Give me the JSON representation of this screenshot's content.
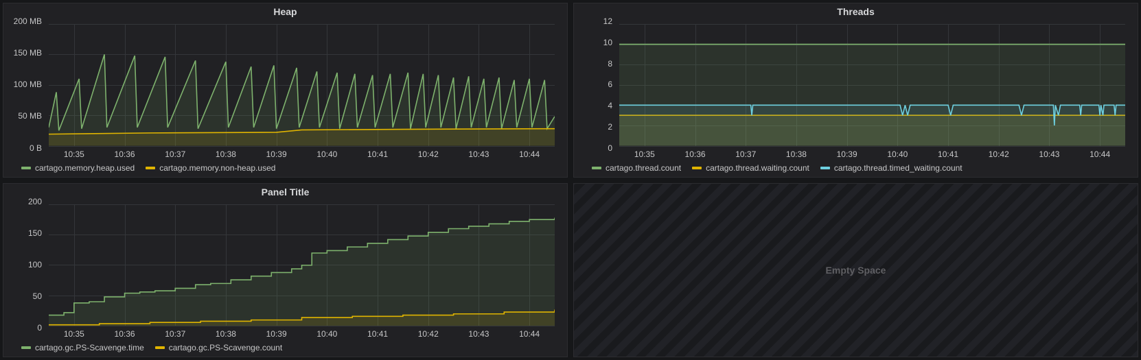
{
  "panels": {
    "heap": {
      "title": "Heap"
    },
    "threads": {
      "title": "Threads"
    },
    "gc": {
      "title": "Panel Title"
    },
    "empty": {
      "title": "Empty Space"
    }
  },
  "colors": {
    "green": "#7eb26d",
    "yellow": "#e0b400",
    "cyan": "#6ed0e0"
  },
  "x_ticks": [
    "10:35",
    "10:36",
    "10:37",
    "10:38",
    "10:39",
    "10:40",
    "10:41",
    "10:42",
    "10:43",
    "10:44"
  ],
  "legends": {
    "heap": [
      {
        "color": "green",
        "label": "cartago.memory.heap.used"
      },
      {
        "color": "yellow",
        "label": "cartago.memory.non-heap.used"
      }
    ],
    "threads": [
      {
        "color": "green",
        "label": "cartago.thread.count"
      },
      {
        "color": "yellow",
        "label": "cartago.thread.waiting.count"
      },
      {
        "color": "cyan",
        "label": "cartago.thread.timed_waiting.count"
      }
    ],
    "gc": [
      {
        "color": "green",
        "label": "cartago.gc.PS-Scavenge.time"
      },
      {
        "color": "yellow",
        "label": "cartago.gc.PS-Scavenge.count"
      }
    ]
  },
  "chart_data": [
    {
      "id": "heap",
      "type": "area",
      "title": "Heap",
      "xlabel": "",
      "ylabel": "",
      "ylim": [
        0,
        200
      ],
      "y_ticks": [
        "0 B",
        "50 MB",
        "100 MB",
        "150 MB",
        "200 MB"
      ],
      "x": [
        0,
        0.5,
        1,
        1.5,
        2,
        2.5,
        3,
        3.5,
        4,
        4.5,
        5,
        5.5,
        6,
        6.5,
        7,
        7.5,
        8,
        8.5,
        9,
        9.5,
        10
      ],
      "series": [
        {
          "name": "cartago.memory.heap.used",
          "color": "green",
          "values": [
            [
              0.0,
              30
            ],
            [
              0.15,
              88
            ],
            [
              0.2,
              25
            ],
            [
              0.6,
              110
            ],
            [
              0.65,
              28
            ],
            [
              1.1,
              150
            ],
            [
              1.15,
              30
            ],
            [
              1.7,
              148
            ],
            [
              1.75,
              30
            ],
            [
              2.3,
              146
            ],
            [
              2.35,
              30
            ],
            [
              2.9,
              140
            ],
            [
              2.95,
              28
            ],
            [
              3.5,
              138
            ],
            [
              3.55,
              30
            ],
            [
              4.0,
              130
            ],
            [
              4.05,
              30
            ],
            [
              4.45,
              132
            ],
            [
              4.5,
              28
            ],
            [
              4.9,
              128
            ],
            [
              4.95,
              30
            ],
            [
              5.3,
              122
            ],
            [
              5.35,
              30
            ],
            [
              5.7,
              120
            ],
            [
              5.75,
              28
            ],
            [
              6.05,
              118
            ],
            [
              6.1,
              30
            ],
            [
              6.4,
              116
            ],
            [
              6.45,
              30
            ],
            [
              6.75,
              118
            ],
            [
              6.8,
              30
            ],
            [
              7.1,
              120
            ],
            [
              7.15,
              28
            ],
            [
              7.4,
              118
            ],
            [
              7.45,
              30
            ],
            [
              7.7,
              116
            ],
            [
              7.75,
              30
            ],
            [
              8.0,
              112
            ],
            [
              8.05,
              28
            ],
            [
              8.3,
              114
            ],
            [
              8.35,
              30
            ],
            [
              8.6,
              110
            ],
            [
              8.65,
              30
            ],
            [
              8.9,
              112
            ],
            [
              8.95,
              28
            ],
            [
              9.2,
              108
            ],
            [
              9.25,
              30
            ],
            [
              9.5,
              110
            ],
            [
              9.55,
              30
            ],
            [
              9.8,
              108
            ],
            [
              9.85,
              28
            ],
            [
              10.0,
              48
            ]
          ]
        },
        {
          "name": "cartago.memory.non-heap.used",
          "color": "yellow",
          "values": [
            [
              0.0,
              19
            ],
            [
              2.0,
              21
            ],
            [
              4.5,
              22
            ],
            [
              5.0,
              26
            ],
            [
              7.0,
              27
            ],
            [
              10.0,
              28
            ]
          ]
        }
      ]
    },
    {
      "id": "threads",
      "type": "area",
      "title": "Threads",
      "xlabel": "",
      "ylabel": "",
      "ylim": [
        0,
        12
      ],
      "y_ticks": [
        "0",
        "2",
        "4",
        "6",
        "8",
        "10",
        "12"
      ],
      "x": [
        0,
        1,
        2,
        3,
        4,
        5,
        6,
        7,
        8,
        9,
        10
      ],
      "series": [
        {
          "name": "cartago.thread.count",
          "color": "green",
          "values": [
            [
              0,
              10
            ],
            [
              10,
              10
            ]
          ]
        },
        {
          "name": "cartago.thread.waiting.count",
          "color": "yellow",
          "values": [
            [
              0,
              3
            ],
            [
              10,
              3
            ]
          ]
        },
        {
          "name": "cartago.thread.timed_waiting.count",
          "color": "cyan",
          "values": [
            [
              0.0,
              4
            ],
            [
              2.6,
              4
            ],
            [
              2.62,
              3
            ],
            [
              2.64,
              4
            ],
            [
              5.55,
              4
            ],
            [
              5.6,
              3
            ],
            [
              5.65,
              4
            ],
            [
              5.7,
              3
            ],
            [
              5.75,
              4
            ],
            [
              6.5,
              4
            ],
            [
              6.55,
              3
            ],
            [
              6.6,
              4
            ],
            [
              7.9,
              4
            ],
            [
              7.95,
              3
            ],
            [
              8.0,
              4
            ],
            [
              8.58,
              4
            ],
            [
              8.6,
              2
            ],
            [
              8.62,
              4
            ],
            [
              8.68,
              3
            ],
            [
              8.72,
              4
            ],
            [
              9.1,
              4
            ],
            [
              9.12,
              3
            ],
            [
              9.14,
              4
            ],
            [
              9.48,
              4
            ],
            [
              9.5,
              3
            ],
            [
              9.52,
              4
            ],
            [
              9.56,
              3
            ],
            [
              9.58,
              4
            ],
            [
              9.78,
              4
            ],
            [
              9.8,
              3
            ],
            [
              9.82,
              4
            ],
            [
              10.0,
              4
            ]
          ]
        }
      ]
    },
    {
      "id": "gc",
      "type": "area",
      "title": "Panel Title",
      "xlabel": "",
      "ylabel": "",
      "ylim": [
        0,
        200
      ],
      "y_ticks": [
        "0",
        "50",
        "100",
        "150",
        "200"
      ],
      "x": [
        0,
        1,
        2,
        3,
        4,
        5,
        6,
        7,
        8,
        9,
        10
      ],
      "series": [
        {
          "name": "cartago.gc.PS-Scavenge.time",
          "color": "green",
          "values": [
            [
              0.0,
              18
            ],
            [
              0.3,
              22
            ],
            [
              0.5,
              38
            ],
            [
              0.8,
              40
            ],
            [
              1.1,
              48
            ],
            [
              1.5,
              54
            ],
            [
              1.8,
              56
            ],
            [
              2.1,
              58
            ],
            [
              2.5,
              62
            ],
            [
              2.9,
              68
            ],
            [
              3.2,
              70
            ],
            [
              3.6,
              76
            ],
            [
              4.0,
              82
            ],
            [
              4.4,
              88
            ],
            [
              4.8,
              94
            ],
            [
              5.0,
              100
            ],
            [
              5.2,
              120
            ],
            [
              5.5,
              124
            ],
            [
              5.9,
              130
            ],
            [
              6.3,
              136
            ],
            [
              6.7,
              142
            ],
            [
              7.1,
              148
            ],
            [
              7.5,
              154
            ],
            [
              7.9,
              160
            ],
            [
              8.3,
              164
            ],
            [
              8.7,
              168
            ],
            [
              9.1,
              172
            ],
            [
              9.5,
              175
            ],
            [
              10.0,
              178
            ]
          ],
          "step": true
        },
        {
          "name": "cartago.gc.PS-Scavenge.count",
          "color": "yellow",
          "values": [
            [
              0.0,
              2
            ],
            [
              1.0,
              4
            ],
            [
              2.0,
              6
            ],
            [
              3.0,
              8
            ],
            [
              4.0,
              10
            ],
            [
              5.0,
              14
            ],
            [
              6.0,
              16
            ],
            [
              7.0,
              18
            ],
            [
              8.0,
              20
            ],
            [
              9.0,
              23
            ],
            [
              10.0,
              27
            ]
          ],
          "step": true
        }
      ]
    }
  ]
}
